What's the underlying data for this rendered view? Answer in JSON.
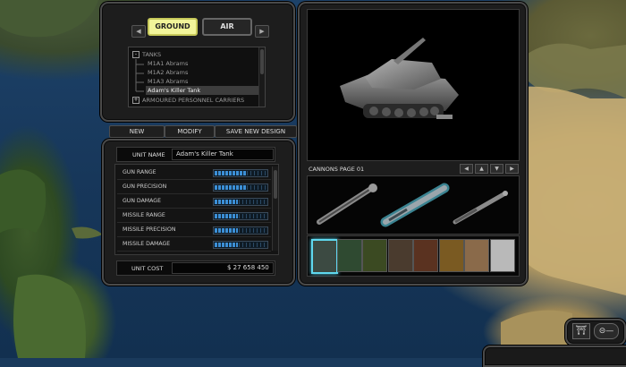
{
  "tabs": {
    "ground": "GROUND",
    "air": "AIR"
  },
  "tree": {
    "category": "TANKS",
    "items": [
      "M1A1 Abrams",
      "M1A2 Abrams",
      "M1A3 Abrams",
      "Adam's Killer Tank"
    ],
    "category2": "ARMOURED PERSONNEL CARRIERS",
    "expand_symbol": "-",
    "collapse_symbol": "+"
  },
  "actions": {
    "new": "NEW",
    "modify": "MODIFY",
    "save": "SAVE NEW DESIGN"
  },
  "unit": {
    "name_label": "UNIT NAME",
    "name_value": "Adam's Killer Tank",
    "cost_label": "UNIT COST",
    "cost_value": "$ 27 658 450"
  },
  "stats": [
    {
      "name": "GUN RANGE",
      "level": 0.6
    },
    {
      "name": "GUN PRECISION",
      "level": 0.6
    },
    {
      "name": "GUN DAMAGE",
      "level": 0.45
    },
    {
      "name": "MISSILE RANGE",
      "level": 0.45
    },
    {
      "name": "MISSILE PRECISION",
      "level": 0.45
    },
    {
      "name": "MISSILE DAMAGE",
      "level": 0.45
    }
  ],
  "cannons": {
    "page_label": "CANNONS PAGE 01",
    "selected_index": 1
  },
  "camo_colors": [
    "#3c4a42",
    "#2f4a31",
    "#3b4a22",
    "#4a3b2e",
    "#5a3220",
    "#7a5a22",
    "#8a6a4a",
    "#b9b9b9"
  ],
  "camo_selected": 0,
  "accent": "#5fd8ee"
}
